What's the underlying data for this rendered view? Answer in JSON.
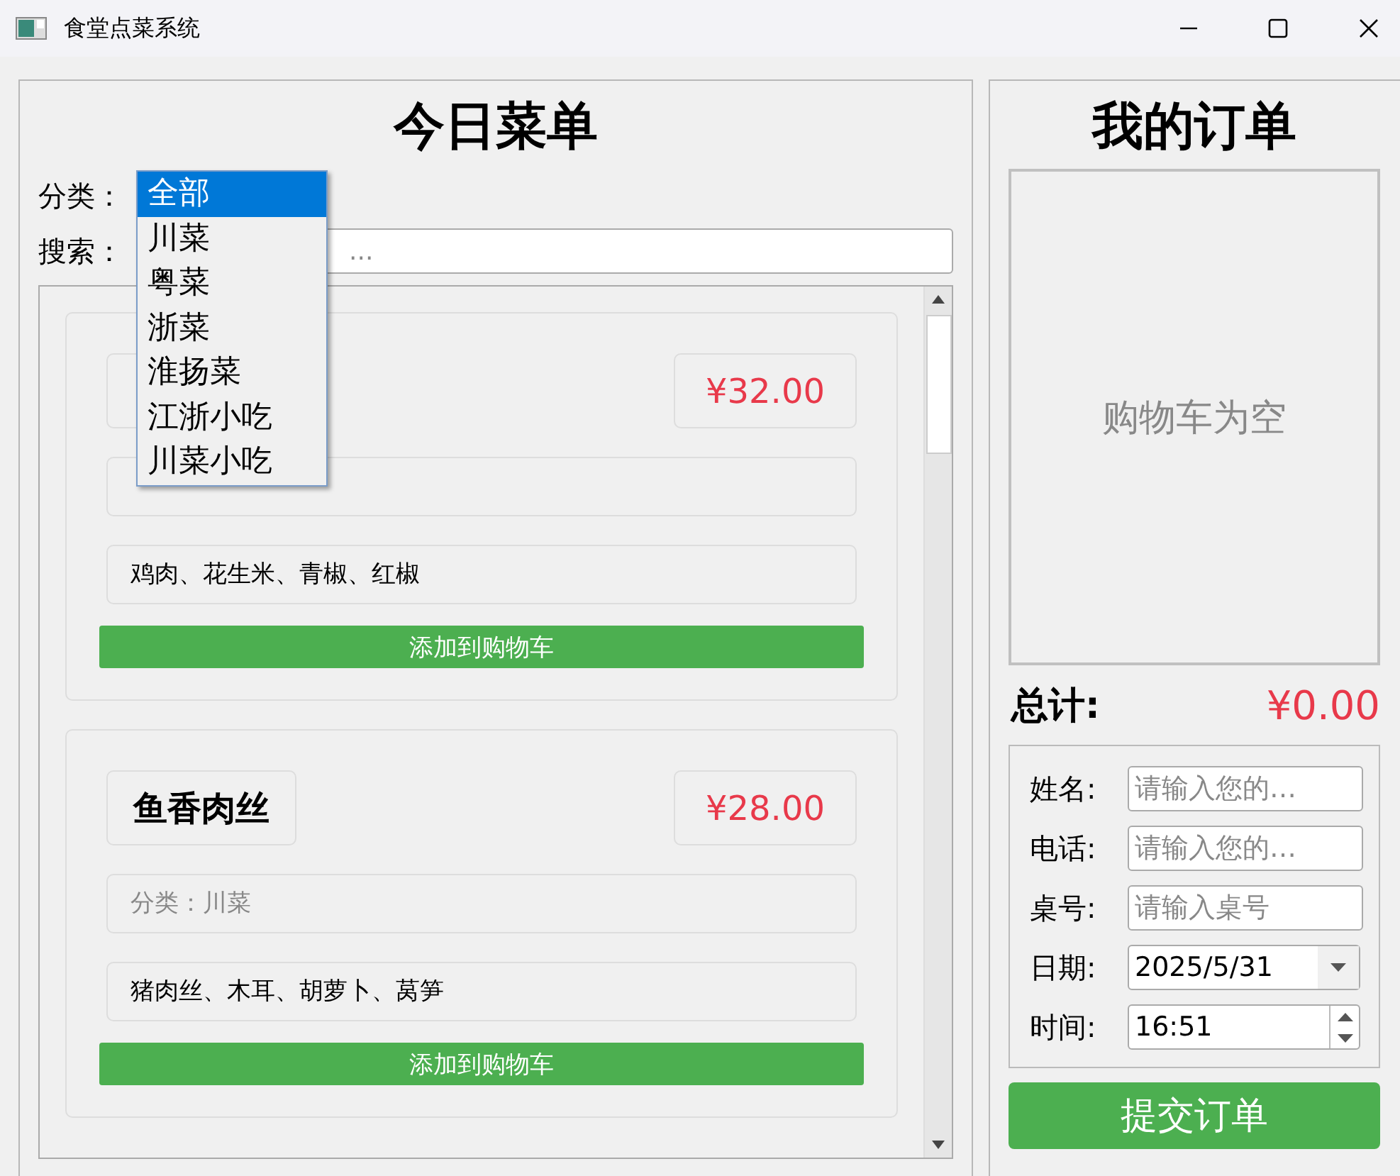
{
  "window": {
    "title": "食堂点菜系统"
  },
  "menu": {
    "title": "今日菜单",
    "category_label": "分类：",
    "search_label": "搜索：",
    "search": {
      "placeholder": "..."
    },
    "category_dropdown": {
      "options": [
        {
          "label": "全部",
          "selected": true
        },
        {
          "label": "川菜",
          "selected": false
        },
        {
          "label": "粤菜",
          "selected": false
        },
        {
          "label": "浙菜",
          "selected": false
        },
        {
          "label": "淮扬菜",
          "selected": false
        },
        {
          "label": "江浙小吃",
          "selected": false
        },
        {
          "label": "川菜小吃",
          "selected": false
        }
      ]
    },
    "dishes": [
      {
        "price": "¥32.00",
        "ingredients": "鸡肉、花生米、青椒、红椒",
        "button": "添加到购物车"
      },
      {
        "name": "鱼香肉丝",
        "price": "¥28.00",
        "category": "分类：川菜",
        "ingredients": "猪肉丝、木耳、胡萝卜、莴笋",
        "button": "添加到购物车"
      }
    ]
  },
  "order": {
    "title": "我的订单",
    "cart_empty": "购物车为空",
    "total_label": "总计:",
    "total": "¥0.00",
    "fields": [
      {
        "kind": "text",
        "label": "姓名:",
        "placeholder": "请输入您的…"
      },
      {
        "kind": "text",
        "label": "电话:",
        "placeholder": "请输入您的…"
      },
      {
        "kind": "text",
        "label": "桌号:",
        "placeholder": "请输入桌号"
      },
      {
        "kind": "date",
        "label": "日期:",
        "value": "2025/5/31"
      },
      {
        "kind": "time",
        "label": "时间:",
        "value": "16:51"
      }
    ],
    "submit": "提交订单"
  }
}
